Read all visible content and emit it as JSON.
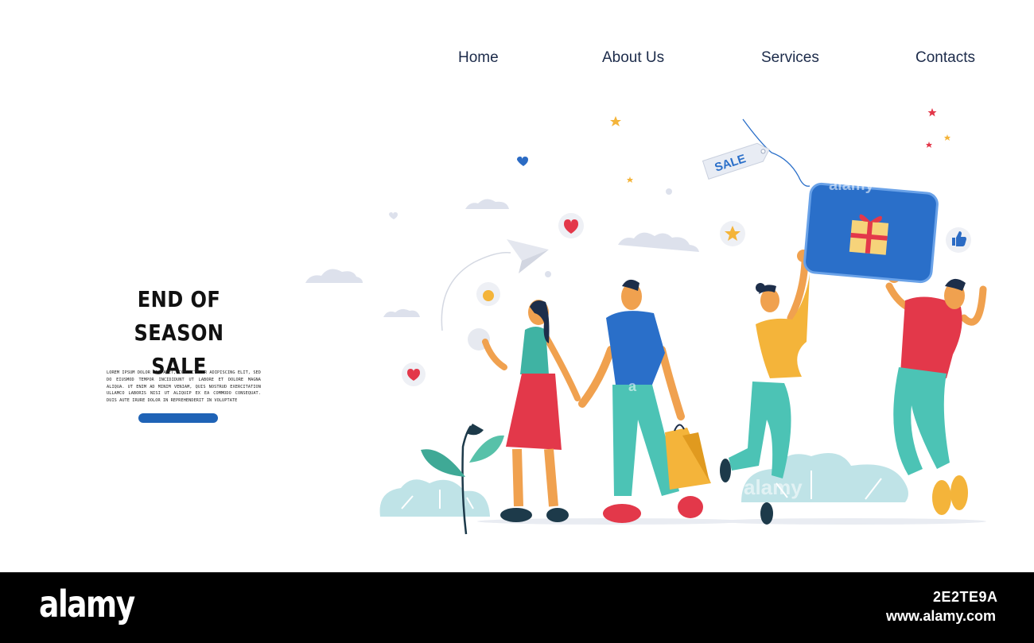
{
  "nav": {
    "items": [
      {
        "label": "Home"
      },
      {
        "label": "About Us"
      },
      {
        "label": "Services"
      },
      {
        "label": "Contacts"
      }
    ]
  },
  "hero": {
    "title_line1": "END OF SEASON",
    "title_line2": "SALE",
    "body": "Lorem ipsum dolor sit amet, consectetur adipiscing elit, sed do eiusmod tempor incididunt ut labore et dolore magna aliqua. Ut enim ad minim veniam, quis nostrud exercitation ullamco laboris nisi ut aliquip ex ea commodo consequat. Duis aute irure dolor in reprehenderit in voluptate"
  },
  "illustration": {
    "sale_tag": "SALE"
  },
  "watermark": {
    "brand": "alamy",
    "image_id": "2E2TE9A",
    "site": "www.alamy.com",
    "overlay_a": "alamy",
    "overlay_b": "a"
  },
  "colors": {
    "nav_text": "#1c2b4a",
    "cta": "#1f63b6",
    "card": "#2a6fc9",
    "skin": "#f0a14f",
    "teal": "#4cc3b5",
    "red": "#e3384a",
    "yellow": "#f4b43a"
  }
}
